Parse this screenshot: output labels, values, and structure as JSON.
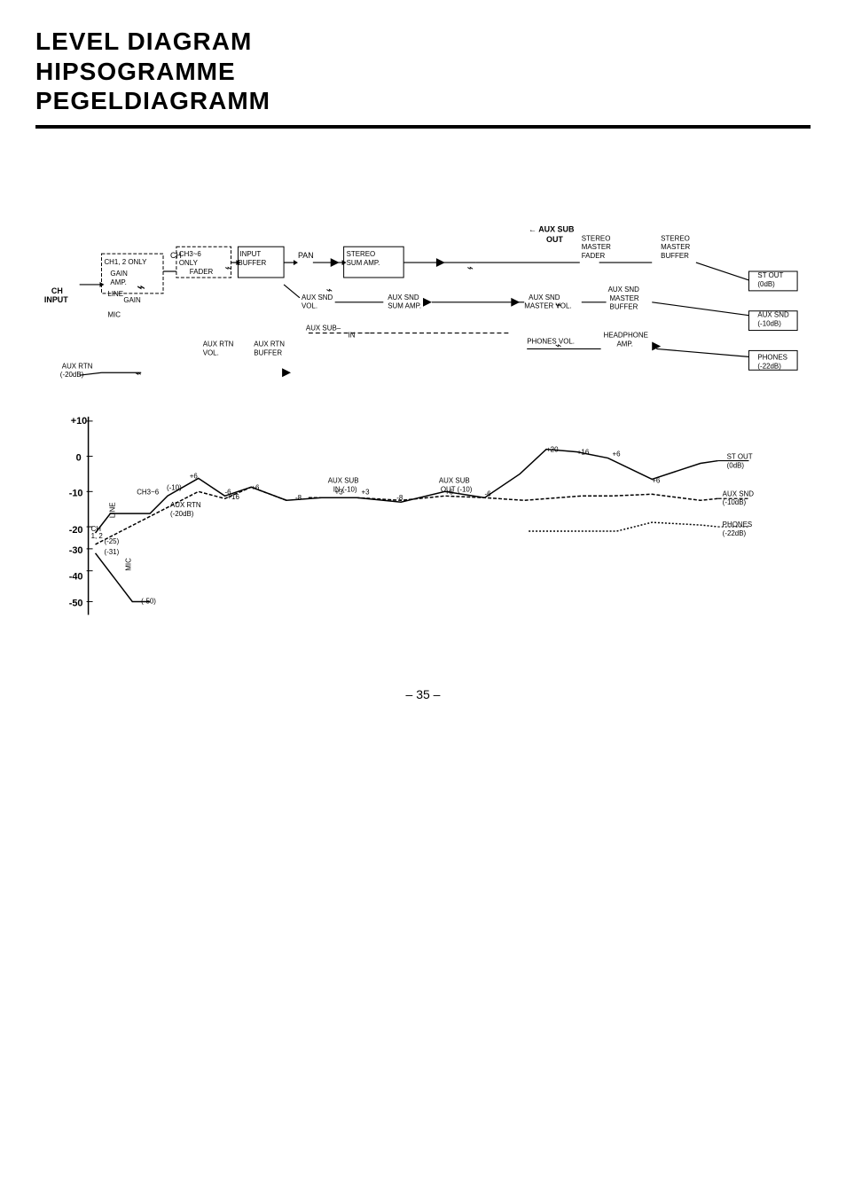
{
  "header": {
    "line1": "LEVEL DIAGRAM",
    "line2": "HIPSOGRAMME",
    "line3": "PEGELDIAGRAMM"
  },
  "page_number": "– 35 –",
  "diagram": {
    "labels": {
      "ch_input": "CH\nINPUT",
      "ch1_2_only": "CH1, 2  ONLY",
      "gain_amp": "GAIN\nAMP.",
      "ch": "CH",
      "ch3_6_only": "CH3~6\nONLY",
      "input_fader": "FADER",
      "input_buffer": "INPUT\nBUFFER",
      "pan": "PAN",
      "stereo_sum_amp": "STEREO\nSUM AMP.",
      "aux_snd_vol": "AUX SND\nVOL.",
      "aux_snd_sum_amp": "AUX SND\nSUM AMP.",
      "aux_sub": "AUX SUB",
      "aux_rtn_vol": "AUX RTN\nVOL.",
      "aux_rtn_buffer": "AUX RTN\nBUFFER",
      "aux_sub_out": "AUX SUB\nOUT",
      "stereo_master_fader": "STEREO\nMASTER\nFADER",
      "stereo_master_buffer": "STEREO\nMASTER\nBUFFER",
      "aux_snd_master_vol": "AUX SND\nMASTER VOL.",
      "aux_snd_master_buffer": "AUX SND\nMASTER\nBUFFER",
      "phones_vol": "PHONES VOL.",
      "headphone_amp": "HEADPHONE\nAMP.",
      "aux_rtn_20db": "AUX RTN\n(-20dB)",
      "st_out_0db": "ST OUT\n(0dB)",
      "aux_snd_10db": "AUX SND\n(-10dB)",
      "phones_22db": "PHONES\n(-22dB)"
    }
  }
}
